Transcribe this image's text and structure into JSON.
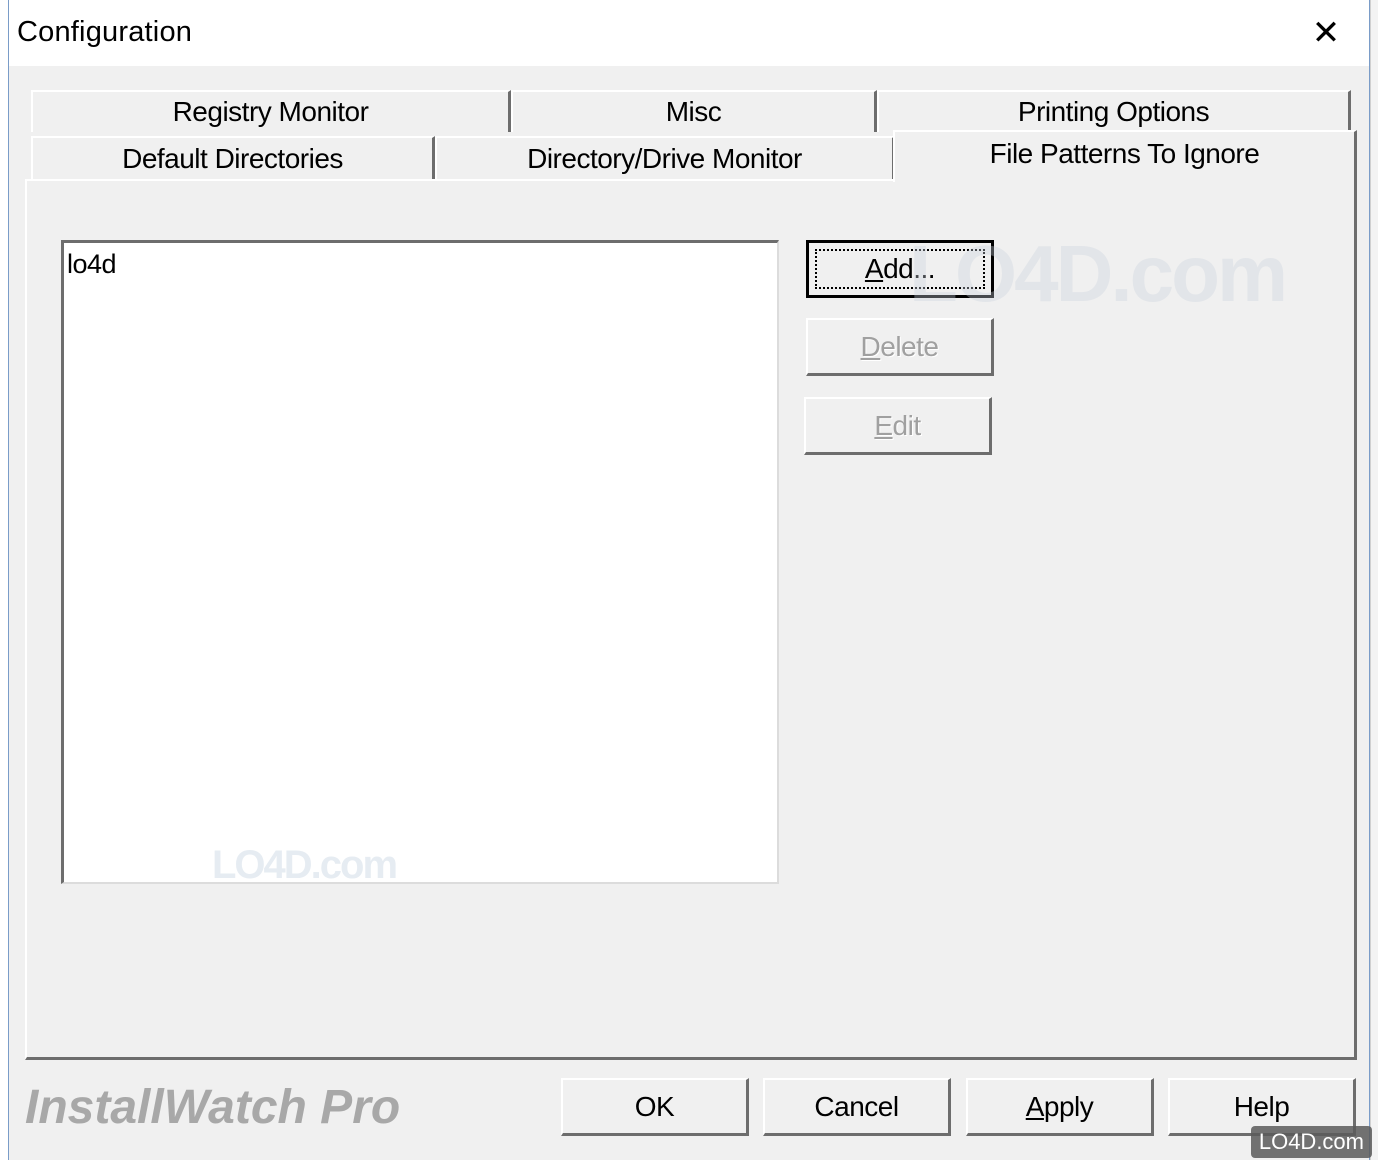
{
  "window": {
    "title": "Configuration",
    "close_glyph": "✕"
  },
  "tabs": {
    "row1": [
      "Registry Monitor",
      "Misc",
      "Printing Options"
    ],
    "row2": [
      "Default Directories",
      "Directory/Drive Monitor"
    ],
    "selected": "File Patterns To Ignore"
  },
  "list": {
    "items": [
      "lo4d"
    ]
  },
  "side_buttons": {
    "add": {
      "prefix": "",
      "accel": "A",
      "rest": "dd..."
    },
    "delete": {
      "prefix": "",
      "accel": "D",
      "rest": "elete"
    },
    "edit": {
      "prefix": "",
      "accel": "E",
      "rest": "dit"
    }
  },
  "footer": {
    "brand": "InstallWatch Pro",
    "ok": "OK",
    "cancel": "Cancel",
    "apply": {
      "accel": "A",
      "rest": "pply"
    },
    "help": "Help"
  },
  "watermark": {
    "large": "LO4D.com",
    "small": "LO4D.com",
    "corner": "LO4D.com"
  }
}
